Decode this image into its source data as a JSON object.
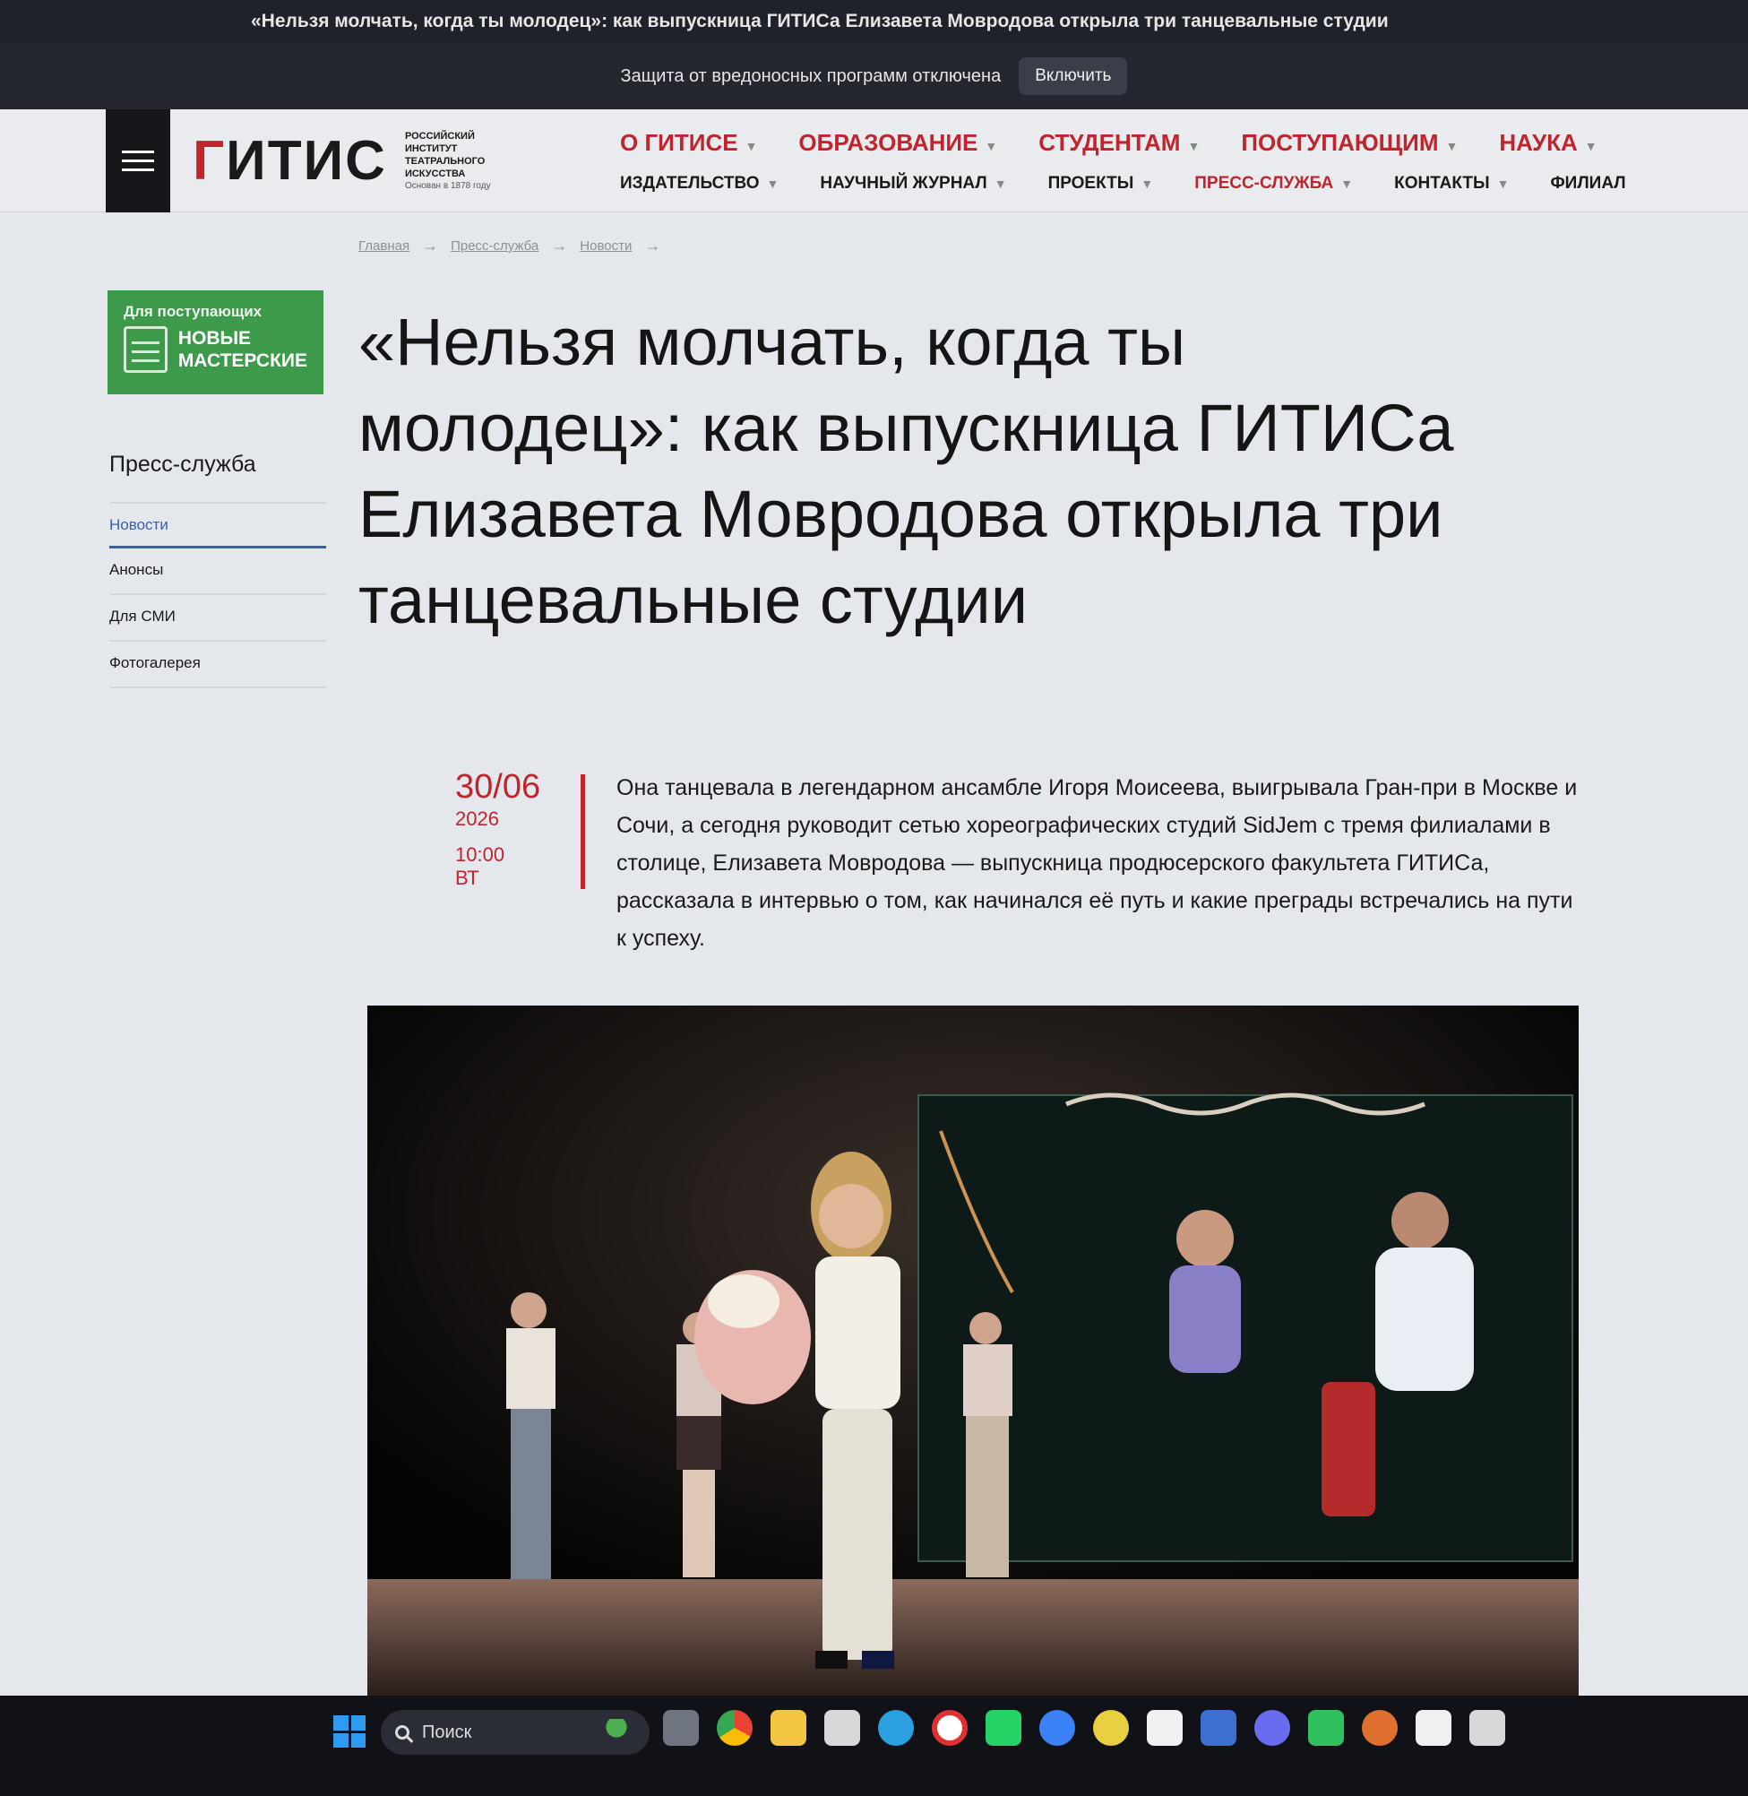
{
  "browser": {
    "tab_title": "«Нельзя молчать, когда ты молодец»: как выпускница ГИТИСа Елизавета Мовродова открыла три танцевальные студии",
    "protection_notice": "Защита от вредоносных программ отключена",
    "protection_button": "Включить"
  },
  "header": {
    "logo_text": "ГИТИС",
    "logo_subtitle_lines": [
      "РОССИЙСКИЙ",
      "ИНСТИТУТ",
      "ТЕАТРАЛЬНОГО",
      "ИСКУССТВА"
    ],
    "logo_founded": "Основан в 1878 году",
    "nav_top": [
      "О ГИТИСЕ",
      "ОБРАЗОВАНИЕ",
      "СТУДЕНТАМ",
      "ПОСТУПАЮЩИМ",
      "НАУКА"
    ],
    "nav_bottom": [
      "ИЗДАТЕЛЬСТВО",
      "НАУЧНЫЙ ЖУРНАЛ",
      "ПРОЕКТЫ",
      "ПРЕСС-СЛУЖБА",
      "КОНТАКТЫ",
      "ФИЛИАЛ"
    ]
  },
  "breadcrumb": [
    "Главная",
    "Пресс-служба",
    "Новости"
  ],
  "promo": {
    "small": "Для поступающих",
    "big_line1": "НОВЫЕ",
    "big_line2": "МАСТЕРСКИЕ"
  },
  "sidebar": {
    "title": "Пресс-служба",
    "items": [
      "Новости",
      "Анонсы",
      "Для СМИ",
      "Фотогалерея"
    ],
    "active": "Новости"
  },
  "article": {
    "headline": "«Нельзя молчать, когда ты молодец»: как выпускница ГИТИСа Елизавета Мовродова открыла три танцевальные студии",
    "date": "30/06",
    "year": "2026",
    "time": "10:00",
    "weekday": "ВТ",
    "lead": "Она танцевала в легендарном ансамбле Игоря Моисеева, выигрывала Гран-при в Москве и Сочи, а сегодня руководит сетью хореографических студий SidJem с тремя филиалами в столице, Елизавета Мовродова — выпускница продюсерского факультета ГИТИСа, рассказала в интервью о том, как начинался её путь и какие преграды встречались на пути к успеху."
  },
  "taskbar": {
    "search_placeholder": "Поиск",
    "apps": [
      "chrome-icon",
      "folder-icon",
      "mail-icon",
      "telegram-icon",
      "yandex-icon",
      "whatsapp-icon",
      "cloud-icon",
      "sun-icon",
      "maps-icon",
      "app-icon",
      "app-icon",
      "chat-icon",
      "spark-icon",
      "maps-icon",
      "mail-icon"
    ]
  },
  "colors": {
    "brand_red": "#c0252e",
    "promo_green": "#3d9a4a",
    "active_link": "#3a5fa8"
  }
}
